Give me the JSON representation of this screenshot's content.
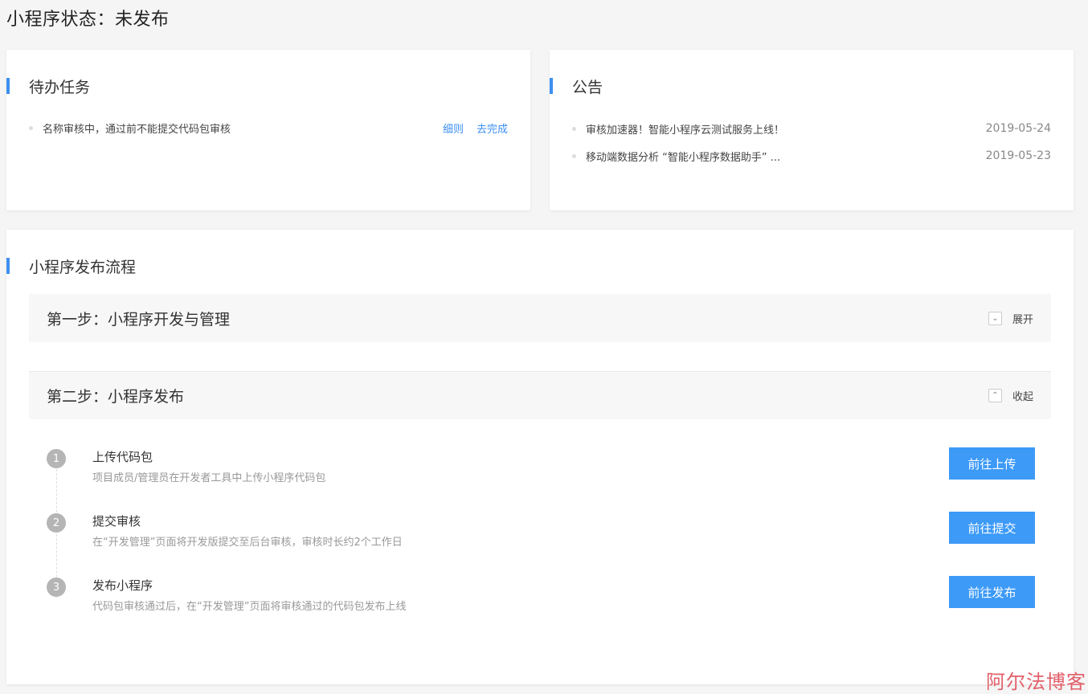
{
  "page": {
    "title": "小程序状态：未发布"
  },
  "todo": {
    "title": "待办任务",
    "items": [
      {
        "text": "名称审核中，通过前不能提交代码包审核",
        "link_rules": "细则",
        "link_complete": "去完成"
      }
    ]
  },
  "notice": {
    "title": "公告",
    "items": [
      {
        "text": "审核加速器！智能小程序云测试服务上线！",
        "date": "2019-05-24"
      },
      {
        "text": "移动端数据分析 “智能小程序数据助手” ...",
        "date": "2019-05-23"
      }
    ]
  },
  "flow": {
    "title": "小程序发布流程",
    "step1": {
      "title": "第一步：小程序开发与管理",
      "toggle": "展开",
      "toggle_icon": "chevron-down-icon"
    },
    "step2": {
      "title": "第二步：小程序发布",
      "toggle": "收起",
      "toggle_icon": "chevron-up-icon"
    },
    "substeps": [
      {
        "num": "1",
        "name": "上传代码包",
        "desc": "项目成员/管理员在开发者工具中上传小程序代码包",
        "button": "前往上传"
      },
      {
        "num": "2",
        "name": "提交审核",
        "desc": "在“开发管理”页面将开发版提交至后台审核，审核时长约2个工作日",
        "button": "前往提交"
      },
      {
        "num": "3",
        "name": "发布小程序",
        "desc": "代码包审核通过后，在“开发管理”页面将审核通过的代码包发布上线",
        "button": "前往发布"
      }
    ]
  },
  "watermark": "阿尔法博客",
  "colors": {
    "accent": "#3d8ff0",
    "button": "#3d9af7",
    "watermark": "#e0606a"
  }
}
